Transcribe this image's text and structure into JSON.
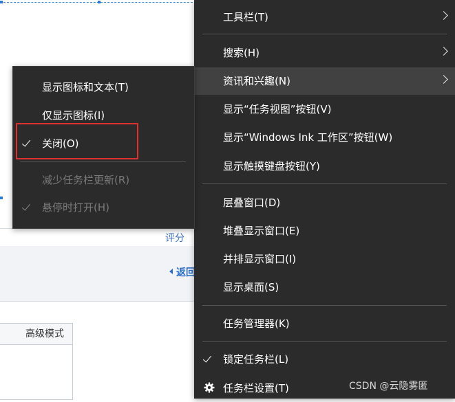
{
  "background": {
    "rating_link": "评分",
    "back_link": "返回",
    "table_header": "高级模式"
  },
  "main_menu": {
    "items": [
      {
        "label": "工具栏(T)",
        "submenu": true
      },
      {
        "label": "搜索(H)",
        "submenu": true
      },
      {
        "label": "资讯和兴趣(N)",
        "submenu": true,
        "highlighted": true
      },
      {
        "label": "显示“任务视图”按钮(V)"
      },
      {
        "label": "显示“Windows Ink 工作区”按钮(W)"
      },
      {
        "label": "显示触摸键盘按钮(Y)"
      },
      {
        "label": "层叠窗口(D)"
      },
      {
        "label": "堆叠显示窗口(E)"
      },
      {
        "label": "并排显示窗口(I)"
      },
      {
        "label": "显示桌面(S)"
      },
      {
        "label": "任务管理器(K)"
      },
      {
        "label": "锁定任务栏(L)",
        "checked": true
      },
      {
        "label": "任务栏设置(T)",
        "icon": "gear-icon"
      }
    ]
  },
  "sub_menu": {
    "items": [
      {
        "label": "显示图标和文本(T)"
      },
      {
        "label": "仅显示图标(I)"
      },
      {
        "label": "关闭(O)",
        "checked": true,
        "annotated": true
      },
      {
        "label": "减少任务栏更新(R)",
        "disabled": true
      },
      {
        "label": "悬停时打开(H)",
        "disabled": true,
        "checked": true
      }
    ]
  },
  "annotation": {
    "color": "#e03131"
  },
  "watermark": "CSDN @云隐雾匿"
}
